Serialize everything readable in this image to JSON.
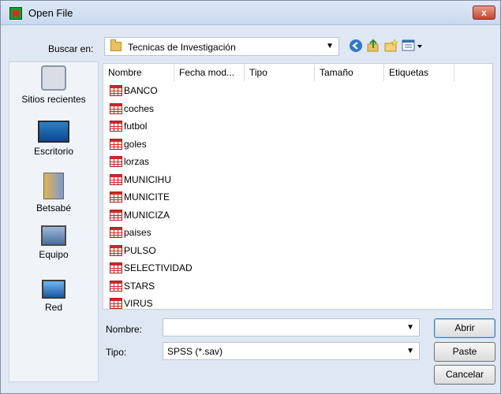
{
  "window": {
    "title": "Open File",
    "close_label": "x"
  },
  "look_in": {
    "label": "Buscar en:",
    "value": "Tecnicas de Investigación"
  },
  "toolbar": {
    "back_icon": "back-arrow-icon",
    "up_icon": "up-folder-icon",
    "new_folder_icon": "new-folder-icon",
    "views_icon": "views-menu-icon"
  },
  "places": [
    {
      "label": "Sitios recientes",
      "icon": "recent-places-icon"
    },
    {
      "label": "Escritorio",
      "icon": "desktop-icon"
    },
    {
      "label": "Betsabé",
      "icon": "user-documents-icon"
    },
    {
      "label": "Equipo",
      "icon": "computer-icon"
    },
    {
      "label": "Red",
      "icon": "network-icon"
    }
  ],
  "columns": [
    "Nombre",
    "Fecha mod...",
    "Tipo",
    "Tamaño",
    "Etiquetas"
  ],
  "files": [
    "BANCO",
    "coches",
    "futbol",
    "goles",
    "lorzas",
    "MUNICIHU",
    "MUNICITE",
    "MUNICIZA",
    "paises",
    "PULSO",
    "SELECTIVIDAD",
    "STARS",
    "VIRUS"
  ],
  "filename": {
    "label": "Nombre:",
    "value": ""
  },
  "filetype": {
    "label": "Tipo:",
    "value": "SPSS (*.sav)"
  },
  "buttons": {
    "open": "Abrir",
    "paste": "Paste",
    "cancel": "Cancelar"
  },
  "colors": {
    "accent": "#3c7fb1",
    "file_icon": "#d32626",
    "titlebar": "#c9d9ee"
  }
}
